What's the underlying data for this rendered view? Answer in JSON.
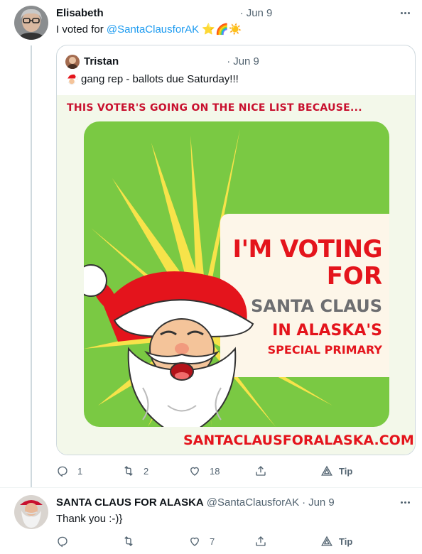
{
  "tweets": [
    {
      "name": "Elisabeth",
      "time": "Jun 9",
      "text_prefix": "I voted for ",
      "mention": "@SantaClausforAK",
      "emoji": "⭐🌈☀️",
      "quote": {
        "name": "Tristan",
        "time": "Jun 9",
        "text": "gang rep - ballots due Saturday!!!",
        "poster": {
          "top_line": "THIS VOTER'S GOING ON THE NICE LIST BECAUSE...",
          "line1": "I'M VOTING",
          "line2": "FOR",
          "line3": "SANTA CLAUS",
          "line4": "IN ALASKA'S",
          "line5": "SPECIAL PRIMARY",
          "url": "SANTACLAUSFORALASKA.COM"
        }
      },
      "actions": {
        "replies": "1",
        "retweets": "2",
        "likes": "18",
        "tip": "Tip"
      }
    },
    {
      "name": "SANTA CLAUS FOR ALASKA",
      "handle": "@SantaClausforAK",
      "time": "Jun 9",
      "text": "Thank you :-)}",
      "actions": {
        "replies": "",
        "retweets": "",
        "likes": "7",
        "tip": "Tip"
      }
    }
  ],
  "icons": [
    "reply-icon",
    "retweet-icon",
    "like-icon",
    "share-icon",
    "tip-icon",
    "more-icon"
  ],
  "colors": {
    "mention": "#1d9bf0",
    "secondary_text": "#536471",
    "poster_red": "#e4141c",
    "poster_green": "#7ac943"
  }
}
